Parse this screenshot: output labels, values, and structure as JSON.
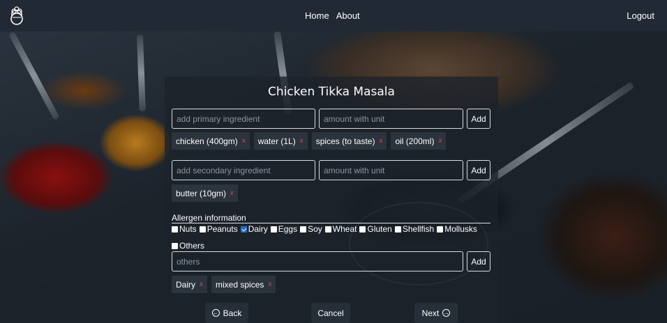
{
  "nav": {
    "home": "Home",
    "about": "About",
    "logout": "Logout"
  },
  "recipe": {
    "title": "Chicken Tikka Masala"
  },
  "primary": {
    "ingredient_placeholder": "add primary ingredient",
    "amount_placeholder": "amount with unit",
    "add_label": "Add",
    "items": [
      "chicken (400gm)",
      "water (1L)",
      "spices (to taste)",
      "oil (200ml)"
    ]
  },
  "secondary": {
    "ingredient_placeholder": "add secondary ingredient",
    "amount_placeholder": "amount with unit",
    "add_label": "Add",
    "items": [
      "butter (10gm)"
    ]
  },
  "allergens": {
    "heading": "Allergen information",
    "options": [
      {
        "label": "Nuts",
        "checked": false
      },
      {
        "label": "Peanuts",
        "checked": false
      },
      {
        "label": "Dairy",
        "checked": true
      },
      {
        "label": "Eggs",
        "checked": false
      },
      {
        "label": "Soy",
        "checked": false
      },
      {
        "label": "Wheat",
        "checked": false
      },
      {
        "label": "Gluten",
        "checked": false
      },
      {
        "label": "Shellfish",
        "checked": false
      },
      {
        "label": "Mollusks",
        "checked": false
      }
    ],
    "others_label": "Others",
    "others_checked": false,
    "others_placeholder": "others",
    "add_label": "Add",
    "items": [
      "Dairy",
      "mixed spices"
    ]
  },
  "remove_symbol": "x",
  "footer": {
    "back": "Back",
    "cancel": "Cancel",
    "next": "Next"
  },
  "colors": {
    "navbar": "#212a34",
    "panel": "#1c222a",
    "remove_x": "#e0454f",
    "checkbox_checked": "#1c6fd1"
  }
}
